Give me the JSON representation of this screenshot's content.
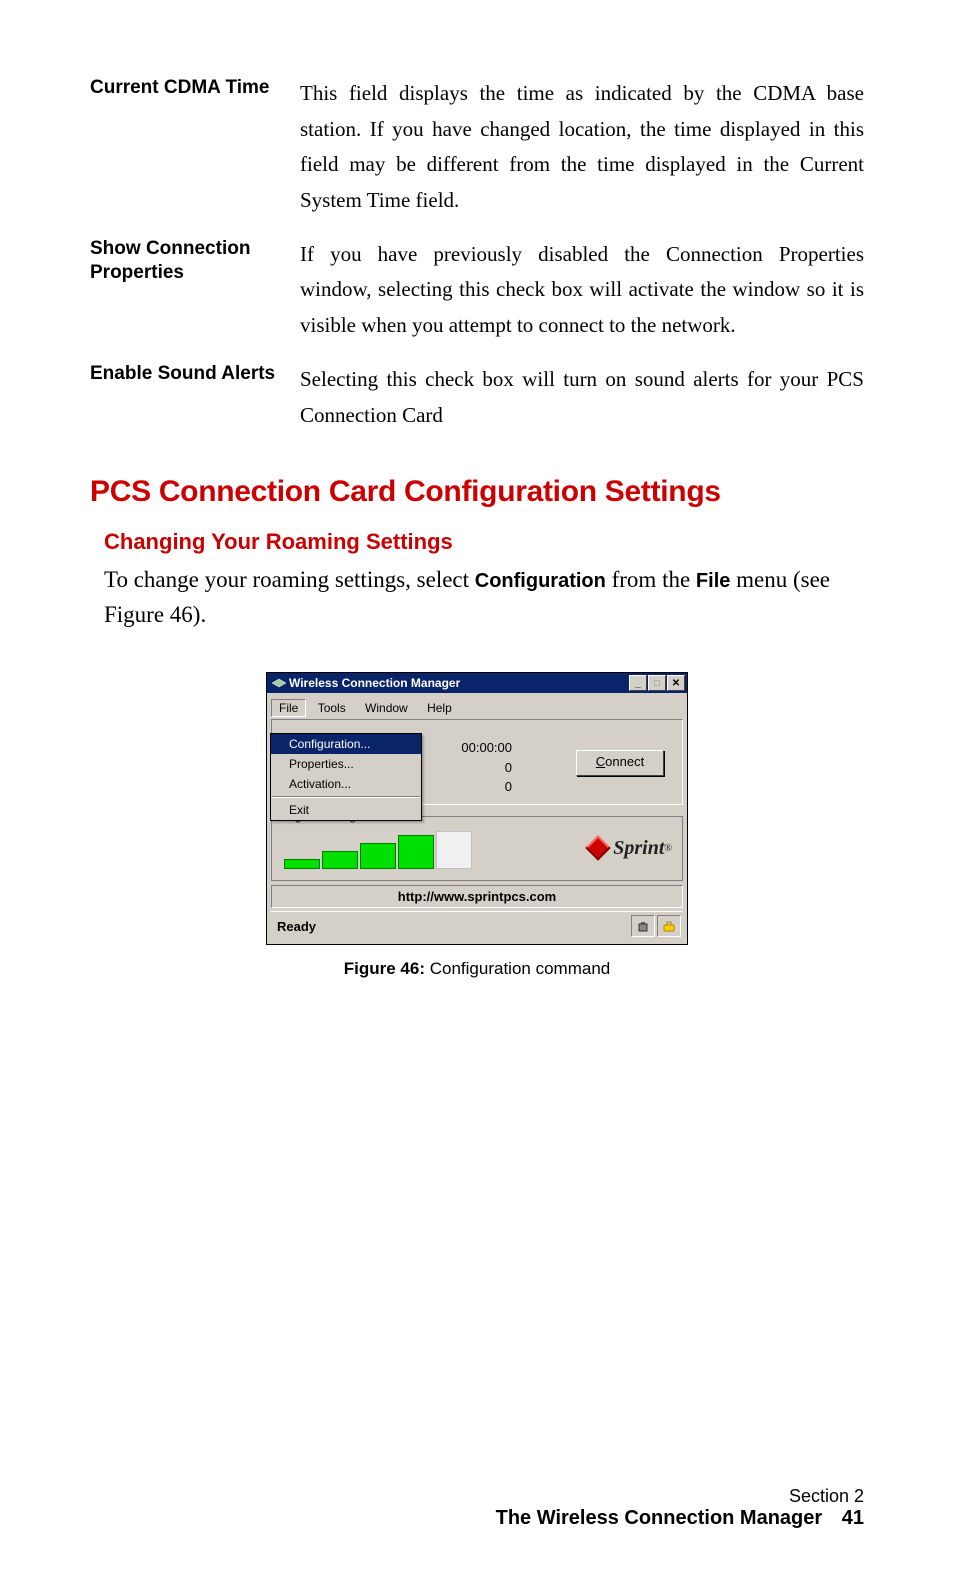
{
  "defs": [
    {
      "term": "Current CDMA Time",
      "desc": "This field displays the time as indicated by the CDMA base station. If you have changed location, the time displayed in this field may be different from the time displayed in the Current System Time field."
    },
    {
      "term": "Show Connection Properties",
      "desc": "If you have previously disabled the Connection Properties window, selecting this check box will activate the window so it is visible when you attempt to connect to the network."
    },
    {
      "term": "Enable Sound Alerts",
      "desc": "Selecting this check box will turn on sound alerts for your PCS Connection Card"
    }
  ],
  "h1": "PCS Connection Card Configuration Settings",
  "h2": "Changing Your Roaming Settings",
  "para": {
    "pre": "To change your roaming settings, select ",
    "b1": "Configuration",
    "mid": " from the ",
    "b2": "File",
    "post": " menu (see Figure 46)."
  },
  "win": {
    "title": "Wireless Connection Manager",
    "menus": [
      "File",
      "Tools",
      "Window",
      "Help"
    ],
    "dropdown": {
      "items": [
        "Configuration...",
        "Properties...",
        "Activation..."
      ],
      "exit": "Exit"
    },
    "timer": "00:00:00",
    "bytes1": "0",
    "bytes2": "0",
    "connect": "Connect",
    "connect_hot": "C",
    "signal_legend": "Signal Strength",
    "sprint": "Sprint",
    "url": "http://www.sprintpcs.com",
    "status": "Ready"
  },
  "caption": {
    "label": "Figure 46:",
    "text": " Configuration command"
  },
  "footer": {
    "section": "Section 2",
    "title": "The Wireless Connection Manager",
    "page": "41"
  }
}
